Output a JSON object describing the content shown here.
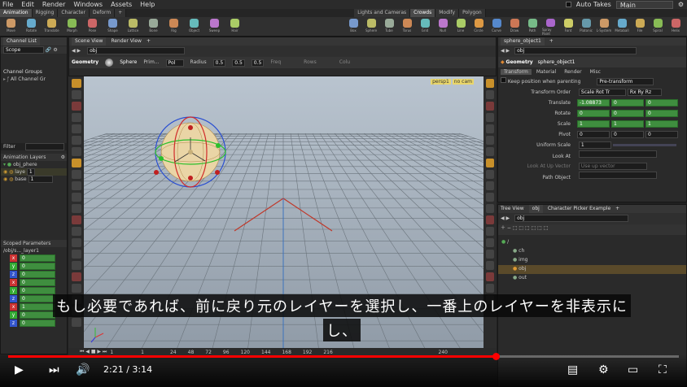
{
  "menu": {
    "items": [
      "File",
      "Edit",
      "Render",
      "Windows",
      "Assets",
      "Help"
    ],
    "auto_takes": "Auto Takes",
    "desktop": "Main"
  },
  "shelf_tabs_left": [
    "Animation",
    "Rigging",
    "Character",
    "Deform"
  ],
  "shelf_tabs_right": [
    "Lights and Cameras",
    "Crowds",
    "Modify",
    "Polygon"
  ],
  "shelf_tools_left": [
    "Move",
    "Rotate",
    "Translate",
    "Morph",
    "Pose",
    "Shape",
    "Lattice",
    "Bone",
    "Rig",
    "Object",
    "Sweep",
    "Hair"
  ],
  "shelf_tools_right": [
    "Box",
    "Sphere",
    "Tube",
    "Torus",
    "Grid",
    "Null",
    "Line",
    "Circle",
    "Curve",
    "Draw",
    "Path",
    "Spray Paint",
    "Font",
    "Platonic",
    "L-System",
    "Metaball",
    "File",
    "Spiral",
    "Helix"
  ],
  "left_panel": {
    "tab": "Channel List",
    "scope": "Scope",
    "channel_groups": "Channel Groups",
    "all_channels": "All Channel Gr",
    "filter": "Filter",
    "anim_layers_title": "Animation Layers",
    "layers": [
      {
        "name": "obj_phere"
      },
      {
        "name": "laye",
        "value": "1"
      },
      {
        "name": "base",
        "value": "1"
      }
    ],
    "scoped_title": "Scoped Parameters",
    "scoped_path": "/obj/s..._layer1",
    "axis_rows": [
      "x",
      "y",
      "z",
      "x",
      "y",
      "z",
      "x",
      "y",
      "z"
    ],
    "axis_vals": [
      "0",
      "0",
      "0",
      "0",
      "0",
      "0",
      "1",
      "0",
      "0"
    ]
  },
  "center": {
    "tabs": [
      "Scene View",
      "Render View"
    ],
    "path": "obj",
    "context": "Geometry",
    "node_type": "Sphere",
    "prim": "Prim...",
    "poly": "Pol",
    "radius_label": "Radius",
    "radius": [
      "0.5",
      "0.5",
      "0.5"
    ],
    "freq": "Freq",
    "rows": "Rows",
    "cols": "Colu",
    "persp": "persp1",
    "cam": "no cam",
    "timeline_left": [
      "1",
      "1"
    ],
    "timeline_ticks": [
      "24",
      "48",
      "72",
      "96",
      "120",
      "144",
      "168",
      "192",
      "216"
    ],
    "frame": "240"
  },
  "right_top": {
    "tab": "sphere_object1",
    "path": "obj",
    "context": "Geometry",
    "node": "sphere_object1",
    "tabs": [
      "Transform",
      "Material",
      "Render",
      "Misc"
    ],
    "keep_pos": "Keep position when parenting",
    "keep_val": "Pre-transform",
    "order_label": "Transform Order",
    "order_val": "Scale Rot Tr",
    "order_val2": "Rx Ry Rz",
    "params": [
      {
        "label": "Translate",
        "vals": [
          "-1.08873",
          "0",
          "0"
        ]
      },
      {
        "label": "Rotate",
        "vals": [
          "0",
          "0",
          "0"
        ]
      },
      {
        "label": "Scale",
        "vals": [
          "1",
          "1",
          "1"
        ]
      },
      {
        "label": "Pivot",
        "vals": [
          "0",
          "0",
          "0"
        ]
      }
    ],
    "uniform_label": "Uniform Scale",
    "uniform_val": "1",
    "lookat_label": "Look At",
    "lookup_label": "Look At Up Vector",
    "lookup_val": "Use up vector",
    "pathobj_label": "Path Object"
  },
  "right_bottom": {
    "tabs": [
      "Tree View",
      "obj",
      "Character Picker Example"
    ],
    "path": "obj",
    "tree": [
      "/",
      "ch",
      "img",
      "obj",
      "out"
    ]
  },
  "subtitle": {
    "line1": "もし必要であれば、前に戻り元のレイヤーを選択し、一番上のレイヤーを非表示に",
    "line2": "し、"
  },
  "player": {
    "time": "2:21 / 3:14",
    "progress": 0.727
  }
}
